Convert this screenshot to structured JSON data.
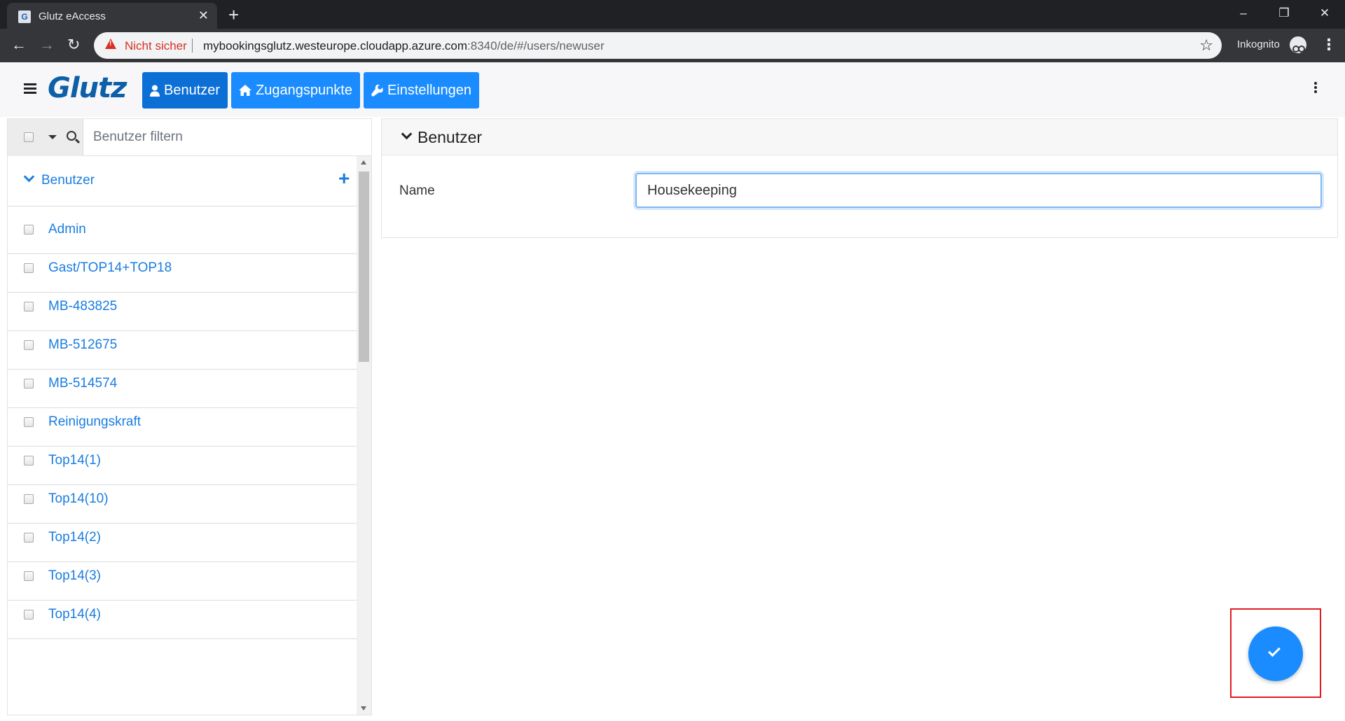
{
  "browser": {
    "tab_title": "Glutz eAccess",
    "tab_favicon_letter": "G",
    "not_secure_label": "Nicht sicher",
    "url_host": "mybookingsglutz.westeurope.cloudapp.azure.com",
    "url_rest": ":8340/de/#/users/newuser",
    "incognito_label": "Inkognito"
  },
  "header": {
    "logo": "Glutz",
    "nav": [
      {
        "label": "Benutzer",
        "icon": "user-icon",
        "active": true
      },
      {
        "label": "Zugangspunkte",
        "icon": "home-icon",
        "active": false
      },
      {
        "label": "Einstellungen",
        "icon": "wrench-icon",
        "active": false
      }
    ]
  },
  "sidebar": {
    "filter_placeholder": "Benutzer filtern",
    "group_label": "Benutzer",
    "items": [
      {
        "label": "Admin"
      },
      {
        "label": "Gast/TOP14+TOP18"
      },
      {
        "label": "MB-483825"
      },
      {
        "label": "MB-512675"
      },
      {
        "label": "MB-514574"
      },
      {
        "label": "Reinigungskraft"
      },
      {
        "label": "Top14(1)"
      },
      {
        "label": "Top14(10)"
      },
      {
        "label": "Top14(2)"
      },
      {
        "label": "Top14(3)"
      },
      {
        "label": "Top14(4)"
      }
    ]
  },
  "main": {
    "card_title": "Benutzer",
    "name_label": "Name",
    "name_value": "Housekeeping"
  },
  "colors": {
    "accent": "#1a8cff",
    "link": "#1a7de0",
    "highlight": "#e01b24"
  }
}
